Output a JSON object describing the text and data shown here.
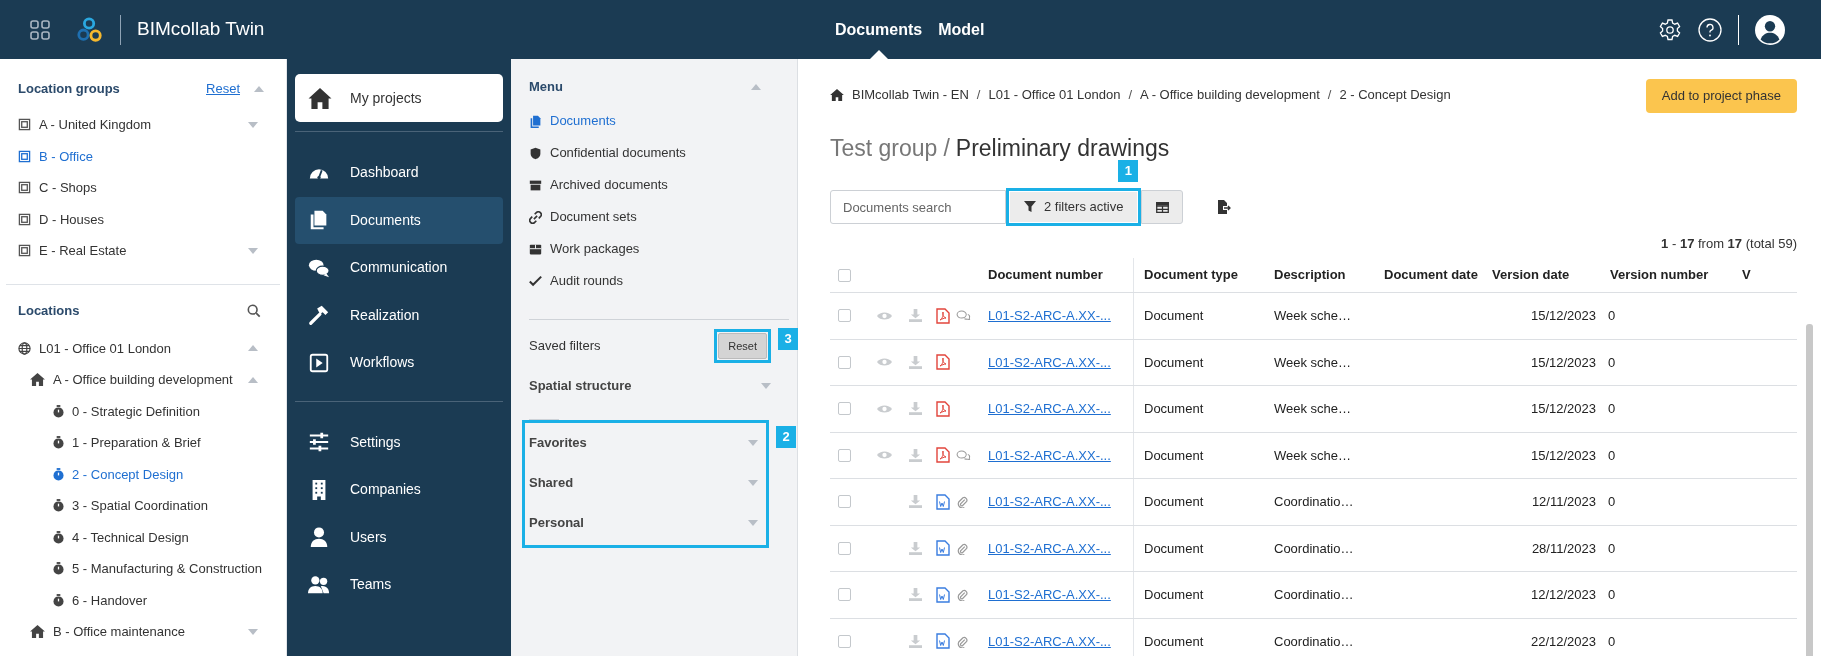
{
  "topbar": {
    "app_name": "BIMcollab Twin",
    "tabs": [
      {
        "label": "Documents",
        "selected": true
      },
      {
        "label": "Model",
        "selected": false
      }
    ]
  },
  "location_groups": {
    "title": "Location groups",
    "reset": "Reset",
    "items": [
      {
        "label": "A - United Kingdom",
        "selected": false,
        "caret": true
      },
      {
        "label": "B - Office",
        "selected": true,
        "caret": false
      },
      {
        "label": "C - Shops",
        "selected": false,
        "caret": false
      },
      {
        "label": "D - Houses",
        "selected": false,
        "caret": false
      },
      {
        "label": "E - Real Estate",
        "selected": false,
        "caret": true
      }
    ]
  },
  "locations": {
    "title": "Locations",
    "tree": [
      {
        "kind": "globe",
        "label": "L01 - Office 01 London",
        "selected": false,
        "expanded": true,
        "children": [
          {
            "kind": "home",
            "label": "A - Office building development",
            "selected": false,
            "expanded": true,
            "children": [
              {
                "kind": "phase",
                "label": "0 - Strategic Definition",
                "selected": false
              },
              {
                "kind": "phase",
                "label": "1 - Preparation & Brief",
                "selected": false
              },
              {
                "kind": "phase",
                "label": "2 - Concept Design",
                "selected": true
              },
              {
                "kind": "phase",
                "label": "3 - Spatial Coordination",
                "selected": false
              },
              {
                "kind": "phase",
                "label": "4 - Technical Design",
                "selected": false
              },
              {
                "kind": "phase",
                "label": "5 - Manufacturing & Construction",
                "selected": false
              },
              {
                "kind": "phase",
                "label": "6 - Handover",
                "selected": false
              }
            ]
          },
          {
            "kind": "home",
            "label": "B - Office maintenance",
            "selected": false,
            "expanded": false
          }
        ]
      }
    ]
  },
  "nav": {
    "my_projects": "My projects",
    "groups": [
      [
        {
          "label": "Dashboard",
          "selected": false
        },
        {
          "label": "Documents",
          "selected": true
        },
        {
          "label": "Communication",
          "selected": false
        },
        {
          "label": "Realization",
          "selected": false
        },
        {
          "label": "Workflows",
          "selected": false
        }
      ],
      [
        {
          "label": "Settings",
          "selected": false
        },
        {
          "label": "Companies",
          "selected": false
        },
        {
          "label": "Users",
          "selected": false
        },
        {
          "label": "Teams",
          "selected": false
        }
      ]
    ]
  },
  "menu": {
    "title": "Menu",
    "items": [
      {
        "label": "Documents",
        "selected": true
      },
      {
        "label": "Confidential documents",
        "selected": false
      },
      {
        "label": "Archived documents",
        "selected": false
      },
      {
        "label": "Document sets",
        "selected": false
      },
      {
        "label": "Work packages",
        "selected": false
      },
      {
        "label": "Audit rounds",
        "selected": false
      }
    ],
    "saved_filters": "Saved filters",
    "reset": "Reset",
    "spatial_structure": "Spatial structure",
    "filter_groups": [
      "Favorites",
      "Shared",
      "Personal"
    ]
  },
  "callouts": [
    "1",
    "2",
    "3"
  ],
  "breadcrumb": [
    "BIMcollab Twin - EN",
    "/",
    "L01 - Office 01 London",
    "/",
    "A - Office building development",
    "/",
    "2 - Concept Design"
  ],
  "add_button": "Add to project phase",
  "title": {
    "group": "Test group",
    "separator": "/",
    "name": "Preliminary drawings"
  },
  "search": {
    "placeholder": "Documents search"
  },
  "filter_button": "2 filters active",
  "count": {
    "range_start": "1",
    "dash": "-",
    "range_end": "17",
    "from": "from",
    "total_shown": "17",
    "total": "(total 59)"
  },
  "table": {
    "select_all_checked": false,
    "columns": [
      "Document number",
      "Document type",
      "Description",
      "Document date",
      "Version date",
      "Version number",
      "V"
    ],
    "rows": [
      {
        "checked": false,
        "preview": true,
        "kind": "pdf",
        "comments": true,
        "attachment": false,
        "document_number": "L01-S2-ARC-A.XX-...",
        "document_type": "Document",
        "description": "Week sche…",
        "version_date": "15/12/2023",
        "version_number": "0"
      },
      {
        "checked": false,
        "preview": true,
        "kind": "pdf",
        "comments": false,
        "attachment": false,
        "document_number": "L01-S2-ARC-A.XX-...",
        "document_type": "Document",
        "description": "Week sche…",
        "version_date": "15/12/2023",
        "version_number": "0"
      },
      {
        "checked": false,
        "preview": true,
        "kind": "pdf",
        "comments": false,
        "attachment": false,
        "document_number": "L01-S2-ARC-A.XX-...",
        "document_type": "Document",
        "description": "Week sche…",
        "version_date": "15/12/2023",
        "version_number": "0"
      },
      {
        "checked": false,
        "preview": true,
        "kind": "pdf",
        "comments": true,
        "attachment": false,
        "document_number": "L01-S2-ARC-A.XX-...",
        "document_type": "Document",
        "description": "Week sche…",
        "version_date": "15/12/2023",
        "version_number": "0"
      },
      {
        "checked": false,
        "preview": false,
        "kind": "word",
        "comments": false,
        "attachment": true,
        "document_number": "L01-S2-ARC-A.XX-...",
        "document_type": "Document",
        "description": "Coordinatio…",
        "version_date": "12/11/2023",
        "version_number": "0"
      },
      {
        "checked": false,
        "preview": false,
        "kind": "word",
        "comments": false,
        "attachment": true,
        "document_number": "L01-S2-ARC-A.XX-...",
        "document_type": "Document",
        "description": "Coordinatio…",
        "version_date": "28/11/2023",
        "version_number": "0"
      },
      {
        "checked": false,
        "preview": false,
        "kind": "word",
        "comments": false,
        "attachment": true,
        "document_number": "L01-S2-ARC-A.XX-...",
        "document_type": "Document",
        "description": "Coordinatio…",
        "version_date": "12/12/2023",
        "version_number": "0"
      },
      {
        "checked": false,
        "preview": false,
        "kind": "word",
        "comments": false,
        "attachment": true,
        "document_number": "L01-S2-ARC-A.XX-...",
        "document_type": "Document",
        "description": "Coordinatio…",
        "version_date": "22/12/2023",
        "version_number": "0"
      }
    ]
  }
}
